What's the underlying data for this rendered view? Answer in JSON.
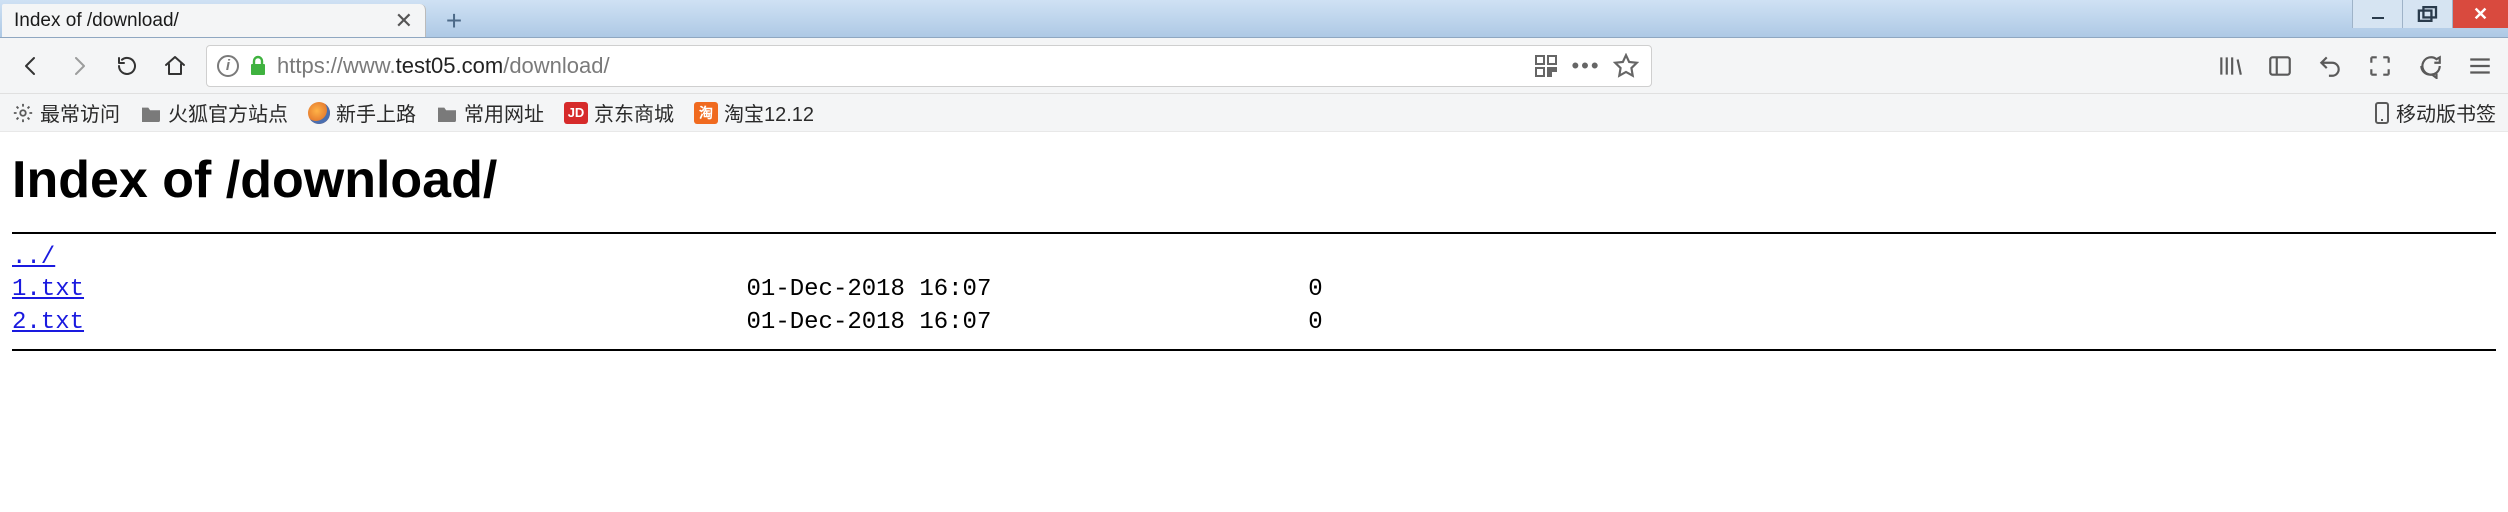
{
  "window": {
    "tab_title": "Index of /download/",
    "controls": {
      "minimize": "min",
      "maximize": "max",
      "close": "close"
    }
  },
  "addressbar": {
    "scheme": "https://www.",
    "host": "test05.com",
    "path": "/download/"
  },
  "bookmarks": {
    "items": [
      {
        "label": "最常访问",
        "kind": "gear"
      },
      {
        "label": "火狐官方站点",
        "kind": "folder"
      },
      {
        "label": "新手上路",
        "kind": "firefox"
      },
      {
        "label": "常用网址",
        "kind": "folder"
      },
      {
        "label": "京东商城",
        "kind": "jd",
        "badge": "JD"
      },
      {
        "label": "淘宝12.12",
        "kind": "taobao",
        "badge": "淘"
      }
    ],
    "mobile_label": "移动版书签"
  },
  "page": {
    "heading": "Index of /download/",
    "parent_link": "../",
    "rows": [
      {
        "name": "1.txt",
        "date": "01-Dec-2018 16:07",
        "size": "0"
      },
      {
        "name": "2.txt",
        "date": "01-Dec-2018 16:07",
        "size": "0"
      }
    ]
  }
}
